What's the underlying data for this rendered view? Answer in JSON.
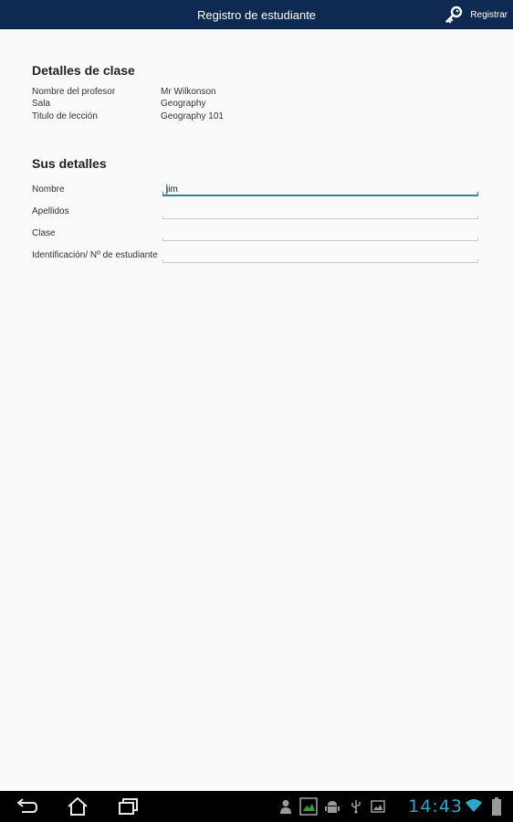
{
  "actionbar": {
    "title": "Registro de estudiante",
    "register_label": "Registrar",
    "register_icon": "key-icon"
  },
  "class_details": {
    "heading": "Detalles de clase",
    "rows": [
      {
        "label": "Nombre del profesor",
        "value": "Mr Wilkonson"
      },
      {
        "label": "Sala",
        "value": "Geography"
      },
      {
        "label": "Titulo de lección",
        "value": "Geography 101"
      }
    ]
  },
  "your_details": {
    "heading": "Sus detalles",
    "fields": [
      {
        "label": "Nombre",
        "value": "jim",
        "focused": true
      },
      {
        "label": "Apellidos",
        "value": ""
      },
      {
        "label": "Clase",
        "value": ""
      },
      {
        "label": "Identificación/ Nº de estudiante",
        "value": ""
      }
    ]
  },
  "system_bar": {
    "time": "14:43",
    "accent": "#29a9c8",
    "nav_icons": [
      "back-icon",
      "home-icon",
      "recent-apps-icon"
    ],
    "status_icons": [
      "user-icon",
      "screenshot-icon",
      "android-debug-icon",
      "usb-icon",
      "gallery-icon",
      "wifi-icon",
      "battery-icon"
    ]
  },
  "colors": {
    "actionbar": "#0e2a52",
    "focus_accent": "#2b8a8f",
    "background": "#fafafa"
  }
}
